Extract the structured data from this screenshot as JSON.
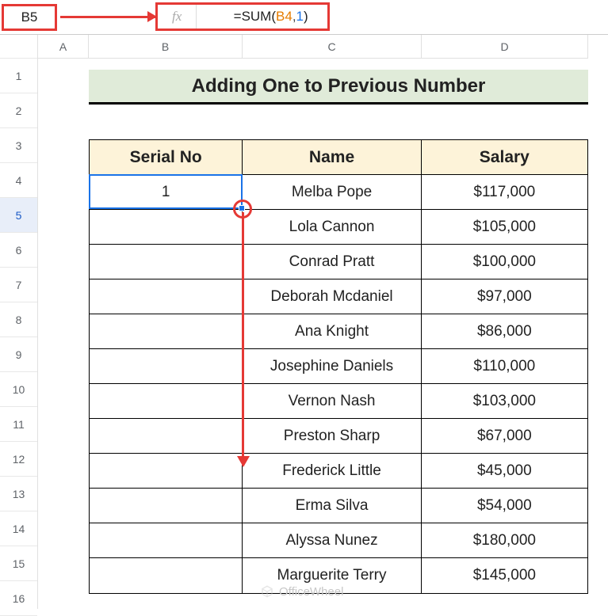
{
  "name_box": "B5",
  "fx_label": "fx",
  "formula": {
    "eq": "=",
    "fn": "SUM",
    "open": "(",
    "ref": "B4",
    "comma": ",",
    "num": "1",
    "close": ")"
  },
  "columns": {
    "A": "A",
    "B": "B",
    "C": "C",
    "D": "D"
  },
  "row_nums": [
    "1",
    "2",
    "3",
    "4",
    "5",
    "6",
    "7",
    "8",
    "9",
    "10",
    "11",
    "12",
    "13",
    "14",
    "15",
    "16"
  ],
  "title": "Adding One to Previous Number",
  "headers": {
    "serial": "Serial No",
    "name": "Name",
    "salary": "Salary"
  },
  "rows": [
    {
      "serial": "1",
      "name": "Melba Pope",
      "salary": "$117,000"
    },
    {
      "serial": "",
      "name": "Lola Cannon",
      "salary": "$105,000"
    },
    {
      "serial": "",
      "name": "Conrad Pratt",
      "salary": "$100,000"
    },
    {
      "serial": "",
      "name": "Deborah Mcdaniel",
      "salary": "$97,000"
    },
    {
      "serial": "",
      "name": "Ana Knight",
      "salary": "$86,000"
    },
    {
      "serial": "",
      "name": "Josephine Daniels",
      "salary": "$110,000"
    },
    {
      "serial": "",
      "name": "Vernon Nash",
      "salary": "$103,000"
    },
    {
      "serial": "",
      "name": "Preston Sharp",
      "salary": "$67,000"
    },
    {
      "serial": "",
      "name": "Frederick Little",
      "salary": "$45,000"
    },
    {
      "serial": "",
      "name": "Erma Silva",
      "salary": "$54,000"
    },
    {
      "serial": "",
      "name": "Alyssa Nunez",
      "salary": "$180,000"
    },
    {
      "serial": "",
      "name": "Marguerite Terry",
      "salary": "$145,000"
    }
  ],
  "watermark": "OfficeWheel"
}
